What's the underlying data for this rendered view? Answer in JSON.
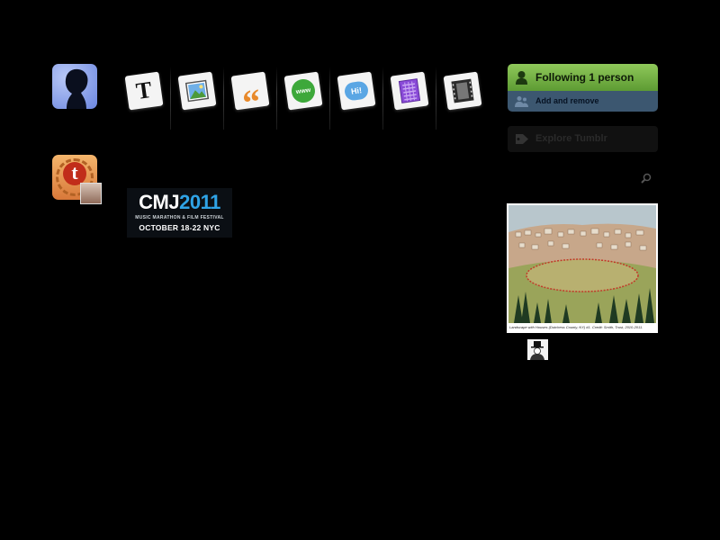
{
  "toolbar": {
    "post_types": [
      {
        "name": "text",
        "glyph": "T"
      },
      {
        "name": "photo",
        "glyph": ""
      },
      {
        "name": "quote",
        "glyph": "“"
      },
      {
        "name": "link",
        "glyph": "www"
      },
      {
        "name": "chat",
        "glyph": "Hi!"
      },
      {
        "name": "audio",
        "glyph": ""
      },
      {
        "name": "video",
        "glyph": ""
      }
    ]
  },
  "sidebar": {
    "following_label": "Following 1 person",
    "add_remove_label": "Add and remove",
    "explore_label": "Explore Tumblr"
  },
  "artwork": {
    "caption": "Landscape with Houses (Dutchess County, NY) #1. Credit: Smith, Trust, 2010-2011."
  },
  "banner": {
    "brand": "CMJ",
    "year": "2011",
    "subtitle": "MUSIC MARATHON & FILM FESTIVAL",
    "dates": "OCTOBER 18-22 NYC"
  },
  "colors": {
    "background": "#000000",
    "following_green": "#7ab847",
    "add_remove_blue": "#3c5770",
    "cmj_blue": "#2fa3e6"
  }
}
